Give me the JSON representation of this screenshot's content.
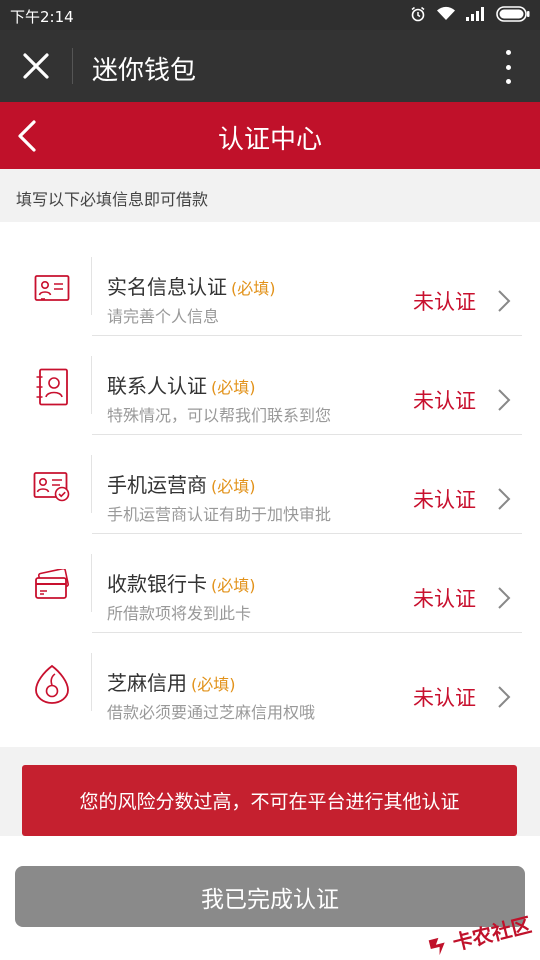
{
  "status_bar": {
    "time": "下午2:14",
    "icons": [
      "alarm-icon",
      "wifi-icon",
      "signal-icon",
      "battery-icon"
    ]
  },
  "app_bar": {
    "title": "迷你钱包",
    "icons": [
      "close-icon",
      "more-vertical-icon"
    ]
  },
  "header": {
    "title": "认证中心",
    "icon": "back-arrow-icon"
  },
  "hint": "填写以下必填信息即可借款",
  "items": [
    {
      "icon": "id-card-icon",
      "title": "实名信息认证",
      "required": "(必填)",
      "desc": "请完善个人信息",
      "status": "未认证"
    },
    {
      "icon": "contact-icon",
      "title": "联系人认证",
      "required": "(必填)",
      "desc": "特殊情况，可以帮我们联系到您",
      "status": "未认证"
    },
    {
      "icon": "carrier-icon",
      "title": "手机运营商",
      "required": "(必填)",
      "desc": "手机运营商认证有助于加快审批",
      "status": "未认证"
    },
    {
      "icon": "bank-card-icon",
      "title": "收款银行卡",
      "required": "(必填)",
      "desc": "所借款项将发到此卡",
      "status": "未认证"
    },
    {
      "icon": "sesame-credit-icon",
      "title": "芝麻信用",
      "required": "(必填)",
      "desc": "借款必须要通过芝麻信用权哦",
      "status": "未认证"
    }
  ],
  "risk_notice": "您的风险分数过高，不可在平台进行其他认证",
  "done_button": "我已完成认证",
  "watermark": "卡农社区",
  "colors": {
    "header_red": "#c0112a",
    "status_red": "#c8102e",
    "required_orange": "#e2921a",
    "app_bar": "#333333"
  }
}
